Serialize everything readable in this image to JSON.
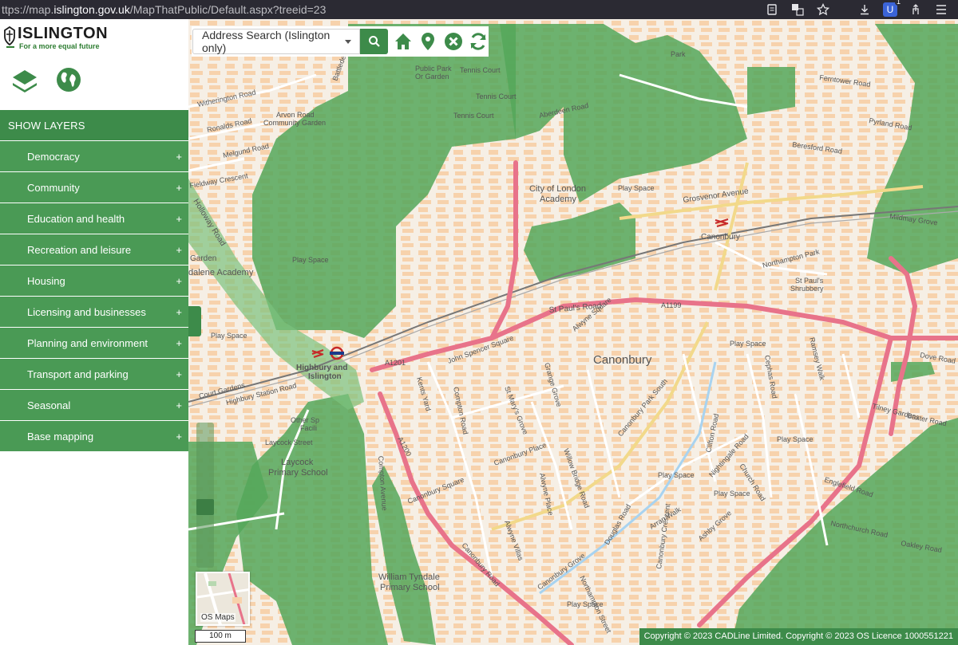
{
  "browser": {
    "url_prefix": "ttps://map.",
    "url_domain": "islington.gov.uk",
    "url_path": "/MapThatPublic/Default.aspx?treeid=23",
    "extension_badge": "1",
    "icons": [
      "reader-icon",
      "translate-icon",
      "star-icon",
      "download-icon",
      "extension-icon",
      "share-icon",
      "menu-icon"
    ]
  },
  "logo": {
    "title": "ISLINGTON",
    "tagline": "For a more equal future"
  },
  "sidebar": {
    "show_layers": "SHOW LAYERS",
    "items": [
      {
        "label": "Democracy",
        "icon": "+"
      },
      {
        "label": "Community",
        "icon": "+"
      },
      {
        "label": "Education and health",
        "icon": "+"
      },
      {
        "label": "Recreation and leisure",
        "icon": "+"
      },
      {
        "label": "Housing",
        "icon": "+"
      },
      {
        "label": "Licensing and businesses",
        "icon": "+"
      },
      {
        "label": "Planning and environment",
        "icon": "+"
      },
      {
        "label": "Transport and parking",
        "icon": "+"
      },
      {
        "label": "Seasonal",
        "icon": "+"
      },
      {
        "label": "Base mapping",
        "icon": "+"
      }
    ]
  },
  "search": {
    "selected": "Address Search (Islington only)"
  },
  "map": {
    "basemap_label": "OS Maps",
    "scale": "100 m",
    "copyright": "Copyright © 2023 CADLine Limited. Copyright © 2023 OS Licence 1000551221",
    "labels": {
      "canonbury_area": "Canonbury",
      "canonbury_station": "Canonbury",
      "highbury_station_1": "Highbury and",
      "highbury_station_2": "Islington",
      "city_academy_1": "City of London",
      "city_academy_2": "Academy",
      "laycock_1": "Laycock",
      "laycock_2": "Primary School",
      "tyndale_1": "William Tyndale",
      "tyndale_2": "Primary School",
      "dalene": "dalene Academy",
      "garden": "Garden",
      "arvon_1": "Arvon Road",
      "arvon_2": "Community Garden",
      "public_park_1": "Public Park",
      "public_park_2": "Or Garden",
      "tennis_court_1": "Tennis Court",
      "tennis_court_2": "Tennis Court",
      "tennis_court_3": "Tennis Court",
      "other_sports_1": "Other Sp",
      "other_sports_2": "Facili",
      "st_pauls_1": "St Paul's",
      "st_pauls_2": "Shrubbery",
      "park": "Park",
      "play_space": "Play Space",
      "a1199": "A1199",
      "a1201": "A1201",
      "a1200": "A1200",
      "roads": {
        "witherington": "Witherington Road",
        "ronalds": "Ronalds Road",
        "melgund": "Melgund Road",
        "fieldway": "Fieldway Crescent",
        "holloway": "Holloway Road",
        "highbury_station_rd": "Highbury Station Road",
        "court_gardens": "Court Gardens",
        "laycock_st": "Laycock Street",
        "grosvenor": "Grosvenor Avenue",
        "st_pauls_rd": "St Paul's Road",
        "northampton_park": "Northampton Park",
        "canonbury_road": "Canonbury Road",
        "canonbury_square": "Canonbury Square",
        "canonbury_place": "Canonbury Place",
        "canonbury_park_south": "Canonbury Park South",
        "alwyne_square": "Alwyne Square",
        "alwyne_villas": "Alwyne Villas",
        "alwyne_place": "Alwyne Place",
        "willow_bridge": "Willow Bridge Road",
        "douglas": "Douglas Road",
        "arran": "Arran Walk",
        "ashby": "Ashby Grove",
        "nightingale": "Nightingale Road",
        "church": "Church Road",
        "clifton": "Clifton Road",
        "englefield": "Englefield Road",
        "northchurch": "Northchurch Road",
        "oakley": "Oakley Road",
        "dove": "Dove Road",
        "baxter": "Baxter Road",
        "ramsey": "Ramsey Walk",
        "cephas": "Cephas Road",
        "john_spencer": "John Spencer Square",
        "compton_road": "Compton Road",
        "compton_avenue": "Compton Avenue",
        "st_marys": "St Mary's Grove",
        "grange": "Grange Grove",
        "kents": "Kents Yard",
        "canonbury_grove": "Canonbury Grove",
        "canonbury_crescent": "Canonbury Crescent",
        "northampton_street": "Northampton Street",
        "pyrland": "Pyrland Road",
        "beresford": "Beresford Road",
        "ferntower": "Ferntower Road",
        "mildmay": "Mildmay Grove",
        "tilney": "Tilney Gardens",
        "aberdeen": "Aberdeen Road",
        "battledean": "Battledean"
      }
    }
  }
}
